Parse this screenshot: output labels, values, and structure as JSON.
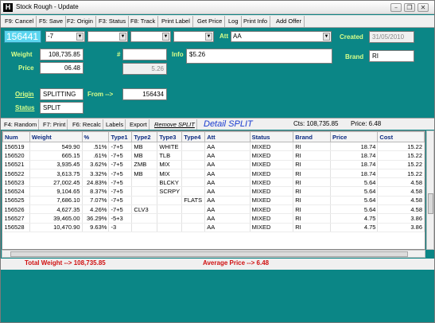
{
  "window": {
    "title": "Stock Rough - Update",
    "app_icon": "H",
    "minimize": "–",
    "restore": "❐",
    "close": "✕"
  },
  "toolbar": [
    "F9: Cancel",
    "F5: Save",
    "F2: Origin",
    "F3: Status",
    "F8: Track",
    "Print Label",
    "Get Price",
    "Log",
    "Print Info",
    "Add Offer"
  ],
  "header": {
    "id": "156441",
    "combo1": "-7",
    "combo2": "",
    "combo3": "",
    "combo4": "",
    "combo5": "",
    "att_label": "Att",
    "att_value": "AA",
    "created_label": "Created",
    "created_value": "31/05/2010"
  },
  "form": {
    "weight_label": "Weight",
    "weight_value": "108,735.85",
    "price_label": "Price",
    "price_value": "06.48",
    "hash_label": "#",
    "hash_value": "",
    "hash_sub_value": "5.26",
    "info_label": "Info",
    "info_value": "$5.26",
    "brand_label": "Brand",
    "brand_value": "RI",
    "origin_label": "Origin",
    "origin_value": "SPLITTING",
    "from_label": "From -->",
    "from_value": "156434",
    "status_label": "Status",
    "status_value": "SPLIT"
  },
  "subbar": {
    "buttons": [
      "F4: Random",
      "F7: Print",
      "F6: Recalc",
      "Labels",
      "Export",
      "Remove SPLIT"
    ],
    "detail_title": "Detail SPLIT",
    "cts_text": "Cts: 108,735.85",
    "price_text": "Price: 6.48"
  },
  "table": {
    "columns": [
      "Num",
      "Weight",
      "%",
      "Type1",
      "Type2",
      "Type3",
      "Type4",
      "Att",
      "Status",
      "Brand",
      "Price",
      "Cost"
    ],
    "rows": [
      [
        "156519",
        "549.90",
        ".51%",
        "-7+5",
        "MB",
        "WHITE",
        "",
        "AA",
        "MIXED",
        "RI",
        "18.74",
        "15.22"
      ],
      [
        "156520",
        "665.15",
        ".61%",
        "-7+5",
        "MB",
        "TLB",
        "",
        "AA",
        "MIXED",
        "RI",
        "18.74",
        "15.22"
      ],
      [
        "156521",
        "3,935.45",
        "3.62%",
        "-7+5",
        "ZMB",
        "MIX",
        "",
        "AA",
        "MIXED",
        "RI",
        "18.74",
        "15.22"
      ],
      [
        "156522",
        "3,613.75",
        "3.32%",
        "-7+5",
        "MB",
        "MIX",
        "",
        "AA",
        "MIXED",
        "RI",
        "18.74",
        "15.22"
      ],
      [
        "156523",
        "27,002.45",
        "24.83%",
        "-7+5",
        "",
        "BLCKY",
        "",
        "AA",
        "MIXED",
        "RI",
        "5.64",
        "4.58"
      ],
      [
        "156524",
        "9,104.65",
        "8.37%",
        "-7+5",
        "",
        "SCRPY",
        "",
        "AA",
        "MIXED",
        "RI",
        "5.64",
        "4.58"
      ],
      [
        "156525",
        "7,686.10",
        "7.07%",
        "-7+5",
        "",
        "",
        "FLATS",
        "AA",
        "MIXED",
        "RI",
        "5.64",
        "4.58"
      ],
      [
        "156526",
        "4,627.35",
        "4.26%",
        "-7+5",
        "CLV3",
        "",
        "",
        "AA",
        "MIXED",
        "RI",
        "5.64",
        "4.58"
      ],
      [
        "156527",
        "39,465.00",
        "36.29%",
        "-5+3",
        "",
        "",
        "",
        "AA",
        "MIXED",
        "RI",
        "4.75",
        "3.86"
      ],
      [
        "156528",
        "10,470.90",
        "9.63%",
        "-3",
        "",
        "",
        "",
        "AA",
        "MIXED",
        "RI",
        "4.75",
        "3.86"
      ]
    ]
  },
  "totals": {
    "total_weight": "Total Weight --> 108,735.85",
    "average_price": "Average Price --> 6.48"
  }
}
